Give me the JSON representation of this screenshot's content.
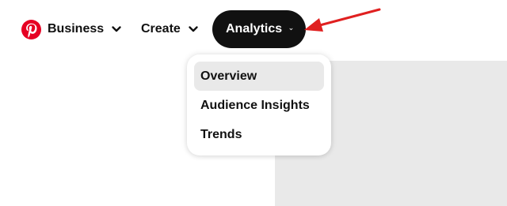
{
  "colors": {
    "brand_red": "#e60023",
    "active_pill": "#111111",
    "active_pill_text": "#ffffff",
    "menu_highlight": "#e9e9e9",
    "arrow": "#e02020",
    "placeholder": "#e9e9e9"
  },
  "logo": {
    "icon": "pinterest-logo-icon"
  },
  "nav": {
    "business_label": "Business",
    "create_label": "Create",
    "analytics_label": "Analytics",
    "chevron_icon": "chevron-down-icon"
  },
  "analytics_menu": {
    "items": [
      {
        "label": "Overview",
        "highlighted": true
      },
      {
        "label": "Audience Insights",
        "highlighted": false
      },
      {
        "label": "Trends",
        "highlighted": false
      }
    ]
  },
  "annotation": {
    "icon": "red-arrow-icon"
  }
}
